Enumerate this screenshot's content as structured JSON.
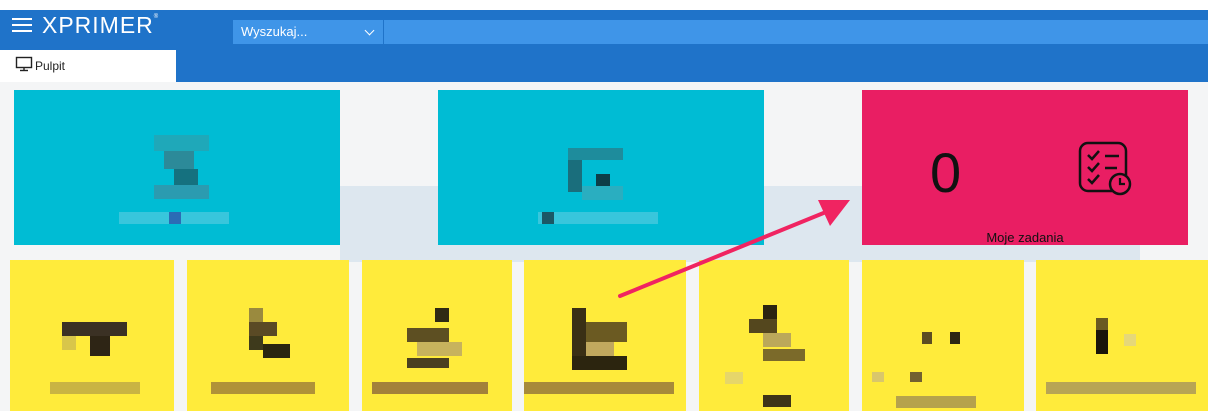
{
  "app": {
    "logo": "XPRIMER",
    "trademark": "®"
  },
  "header": {
    "search_value": "Wyszukaj..."
  },
  "tabs": [
    {
      "label": "Pulpit",
      "icon": "monitor-icon"
    }
  ],
  "dashboard": {
    "tasks_tile": {
      "count": "0",
      "label": "Moje zadania",
      "icon": "task-checklist-clock-icon",
      "color": "#e91e63"
    }
  },
  "colors": {
    "header": "#1f73c9",
    "search": "#3f95e8",
    "tile_cyan": "#00bcd4",
    "tile_yellow": "#ffeb3b",
    "arrow": "#f02461"
  }
}
